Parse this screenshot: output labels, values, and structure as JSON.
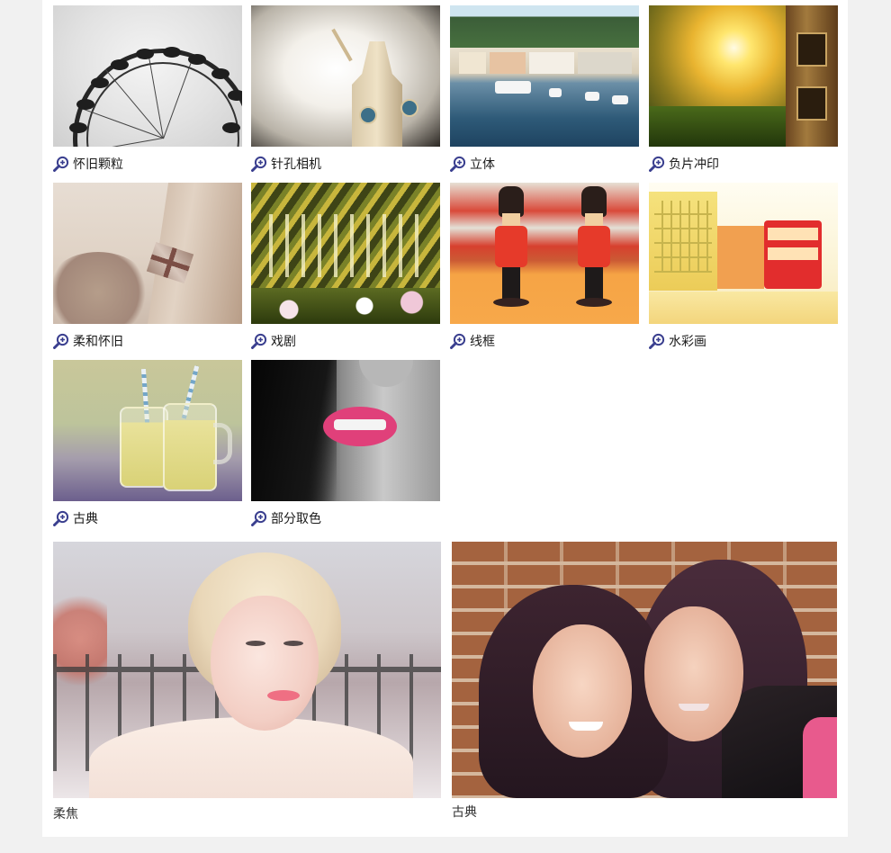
{
  "filters": [
    {
      "label": "怀旧颗粒",
      "icon": "zoom-in-icon"
    },
    {
      "label": "针孔相机",
      "icon": "zoom-in-icon"
    },
    {
      "label": "立体",
      "icon": "zoom-in-icon"
    },
    {
      "label": "负片冲印",
      "icon": "zoom-in-icon"
    },
    {
      "label": "柔和怀旧",
      "icon": "zoom-in-icon"
    },
    {
      "label": "戏剧",
      "icon": "zoom-in-icon"
    },
    {
      "label": "线框",
      "icon": "zoom-in-icon"
    },
    {
      "label": "水彩画",
      "icon": "zoom-in-icon"
    },
    {
      "label": "古典",
      "icon": "zoom-in-icon"
    },
    {
      "label": "部分取色",
      "icon": "zoom-in-icon"
    }
  ],
  "showcase": [
    {
      "label": "柔焦"
    },
    {
      "label": "古典"
    }
  ],
  "colors": {
    "page_background": "#f1f1f1",
    "panel_background": "#ffffff",
    "icon_color": "#3a3f8f",
    "caption_text": "#1a1a1a"
  }
}
